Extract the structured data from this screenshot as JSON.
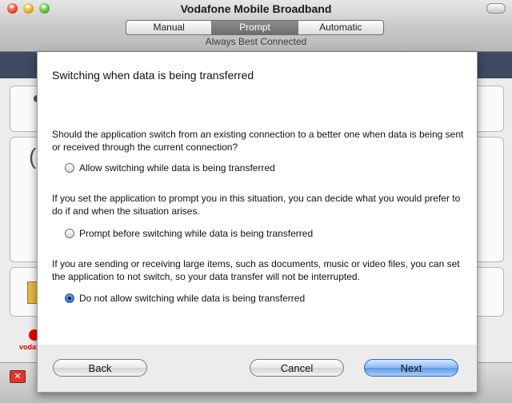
{
  "window": {
    "title": "Vodafone Mobile Broadband",
    "modes": [
      "Manual",
      "Prompt",
      "Automatic"
    ],
    "selected_mode": "Prompt",
    "subtitle": "Always Best Connected"
  },
  "background": {
    "brand_text": "vodafone",
    "brand_color": "#e60000"
  },
  "dialog": {
    "title": "Switching when data is being transferred",
    "question": "Should the application switch from an existing connection to a better one when data is being sent or received through the current connection?",
    "option1_label": "Allow switching while data is being transferred",
    "prompt_description": "If you set the application to prompt you in this situation, you can decide what you would prefer to do if and when the situation arises.",
    "option2_label": "Prompt before switching while data is being transferred",
    "large_items_description": "If you are sending or receiving large items, such as documents, music or video files, you can set the application to not switch, so your data transfer will not be interrupted.",
    "option3_label": "Do not allow switching while data is being transferred",
    "selected_option": "Do not allow switching while data is being transferred",
    "buttons": {
      "back": "Back",
      "cancel": "Cancel",
      "next": "Next"
    }
  }
}
